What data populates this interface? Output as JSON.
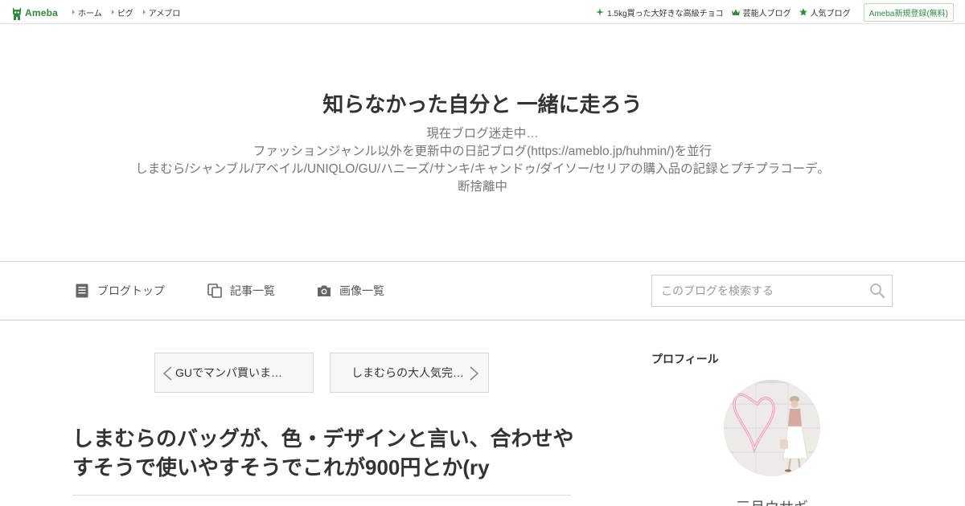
{
  "topbar": {
    "logo_text": "Ameba",
    "nav": [
      "ホーム",
      "ピグ",
      "アメブロ"
    ],
    "right_links": [
      {
        "label": "1.5kg買った大好きな高級チョコ",
        "icon": "sparkle-icon"
      },
      {
        "label": "芸能人ブログ",
        "icon": "crown-icon"
      },
      {
        "label": "人気ブログ",
        "icon": "star-icon"
      }
    ],
    "register_label": "Ameba新規登録(無料)"
  },
  "blog": {
    "title": "知らなかった自分と 一緒に走ろう",
    "description": [
      "現在ブログ迷走中…",
      "ファッションジャンル以外を更新中の日記ブログ(https://ameblo.jp/huhmin/)を並行",
      "しまむら/シャンブル/アベイル/UNIQLO/GU/ハニーズ/サンキ/キャンドゥ/ダイソー/セリアの購入品の記録とプチプラコーデ。",
      "断捨離中"
    ]
  },
  "blog_nav": {
    "items": [
      {
        "label": "ブログトップ",
        "icon": "document-icon"
      },
      {
        "label": "記事一覧",
        "icon": "copy-pages-icon"
      },
      {
        "label": "画像一覧",
        "icon": "camera-icon"
      }
    ],
    "search_placeholder": "このブログを検索する"
  },
  "article": {
    "prev_label": "GUでマンパ買いま…",
    "next_label": "しまむらの大人気完…",
    "title": "しまむらのバッグが、色・デザインと言い、合わせやすそうで使いやすそうでこれが900円とか(ry"
  },
  "sidebar": {
    "profile_heading": "プロフィール",
    "profile_name": "三月ウサギ"
  },
  "colors": {
    "brand_green": "#2d8c3c",
    "text": "#333333",
    "muted": "#777777",
    "border": "#d4d4d4",
    "neon_pink": "#f39ab6"
  }
}
